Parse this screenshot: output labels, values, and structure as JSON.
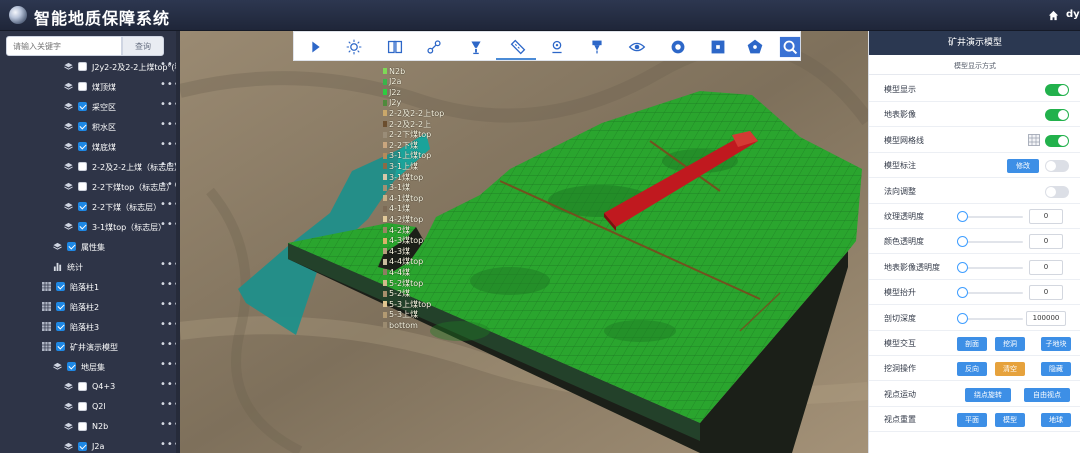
{
  "header": {
    "title": "智能地质保障系统",
    "user": "dy"
  },
  "sidebar": {
    "search_placeholder": "请输入关键字",
    "search_button": "查询",
    "rows": [
      {
        "label": "J2y2-2及2-2上煤top°(标志层)",
        "indent": 1,
        "icon": "layer",
        "checked": false,
        "more": true
      },
      {
        "label": "煤顶煤",
        "indent": 1,
        "icon": "layer",
        "checked": false,
        "more": true
      },
      {
        "label": "采空区",
        "indent": 1,
        "icon": "layer",
        "checked": true,
        "more": true
      },
      {
        "label": "积水区",
        "indent": 1,
        "icon": "layer",
        "checked": true,
        "more": true
      },
      {
        "label": "煤底煤",
        "indent": 1,
        "icon": "layer",
        "checked": true,
        "more": true
      },
      {
        "label": "2-2及2-2上煤（标志层）",
        "indent": 1,
        "icon": "layer",
        "checked": false,
        "more": true
      },
      {
        "label": "2-2下煤top（标志层）°",
        "indent": 1,
        "icon": "layer",
        "checked": false,
        "more": true
      },
      {
        "label": "2-2下煤（标志层）",
        "indent": 1,
        "icon": "layer",
        "checked": true,
        "more": true
      },
      {
        "label": "3-1煤top（标志层）",
        "indent": 1,
        "icon": "layer",
        "checked": true,
        "more": true
      },
      {
        "label": "属性集",
        "indent": 0.5,
        "icon": "layer",
        "checked": true,
        "more": false
      },
      {
        "label": "统计",
        "indent": 0.5,
        "icon": "bars",
        "checked": null,
        "more": true
      },
      {
        "label": "陷落柱1",
        "indent": 0,
        "icon": "grid",
        "checked": true,
        "more": true
      },
      {
        "label": "陷落柱2",
        "indent": 0,
        "icon": "grid",
        "checked": true,
        "more": true
      },
      {
        "label": "陷落柱3",
        "indent": 0,
        "icon": "grid",
        "checked": true,
        "more": true
      },
      {
        "label": "矿井演示模型",
        "indent": 0,
        "icon": "grid",
        "checked": true,
        "more": true
      },
      {
        "label": "地层集",
        "indent": 0.5,
        "icon": "layer",
        "checked": true,
        "more": true
      },
      {
        "label": "Q4+3",
        "indent": 1,
        "icon": "layer",
        "checked": false,
        "more": true
      },
      {
        "label": "Q2l",
        "indent": 1,
        "icon": "layer",
        "checked": false,
        "more": true
      },
      {
        "label": "N2b",
        "indent": 1,
        "icon": "layer",
        "checked": false,
        "more": true
      },
      {
        "label": "J2a",
        "indent": 1,
        "icon": "layer",
        "checked": true,
        "more": true
      }
    ]
  },
  "layers": [
    {
      "label": "N2b",
      "color": "#7ed957"
    },
    {
      "label": "J2a",
      "color": "#39b54a"
    },
    {
      "label": "J2z",
      "color": "#2ecc40"
    },
    {
      "label": "J2y",
      "color": "#4f8a3c"
    },
    {
      "label": "2-2及2-2上top",
      "color": "#caa86a"
    },
    {
      "label": "2-2及2-2上",
      "color": "#6b4e2e"
    },
    {
      "label": "2-2下煤top",
      "color": "#9a8d78"
    },
    {
      "label": "2-2下煤",
      "color": "#c9a67e"
    },
    {
      "label": "3-1上煤top",
      "color": "#b58b5a"
    },
    {
      "label": "3-1上煤",
      "color": "#8b6a45"
    },
    {
      "label": "3-1煤top",
      "color": "#d5c7a8"
    },
    {
      "label": "3-1煤",
      "color": "#a39173"
    },
    {
      "label": "4-1煤top",
      "color": "#c8b087"
    },
    {
      "label": "4-1煤",
      "color": "#7c6a55"
    },
    {
      "label": "4-2煤top",
      "color": "#e2c999"
    },
    {
      "label": "4-2煤",
      "color": "#9a8663"
    },
    {
      "label": "4-3煤top",
      "color": "#d9b26a"
    },
    {
      "label": "4-3煤",
      "color": "#b7a07d"
    },
    {
      "label": "4-4煤top",
      "color": "#c9bb9c"
    },
    {
      "label": "4-4煤",
      "color": "#8f7d62"
    },
    {
      "label": "5-2煤top",
      "color": "#d2b98c"
    },
    {
      "label": "5-2煤",
      "color": "#a78f6c"
    },
    {
      "label": "5-3上煤top",
      "color": "#e0c58f"
    },
    {
      "label": "5-3上煤",
      "color": "#b29a72"
    },
    {
      "label": "bottom",
      "color": "#9b8b70"
    }
  ],
  "toolbar": {
    "icons": [
      "play-icon",
      "sun-icon",
      "book-icon",
      "route-icon",
      "lamp-icon",
      "ruler-icon",
      "location-icon",
      "pin-icon",
      "eye-icon",
      "circle-icon",
      "square-icon",
      "pentagon-icon",
      "search-icon"
    ],
    "active_index": 5
  },
  "panel": {
    "title": "矿井演示模型",
    "subtitle": "模型显示方式",
    "rows": [
      {
        "label": "模型显示",
        "control": "toggle",
        "on": true
      },
      {
        "label": "地表影像",
        "control": "toggle",
        "on": true
      },
      {
        "label": "模型网格线",
        "control": "toggle_grid",
        "on": true
      },
      {
        "label": "模型标注",
        "control": "button_toggle",
        "button": "修改",
        "on": false
      },
      {
        "label": "法向调整",
        "control": "toggle",
        "on": false
      },
      {
        "label": "纹理透明度",
        "control": "slider",
        "value": "0"
      },
      {
        "label": "颜色透明度",
        "control": "slider",
        "value": "0"
      },
      {
        "label": "地表影像透明度",
        "control": "slider",
        "value": "0"
      },
      {
        "label": "模型抬升",
        "control": "slider",
        "value": "0"
      },
      {
        "label": "剖切深度",
        "control": "slider_wide",
        "value": "100000"
      },
      {
        "label": "模型交互",
        "control": "buttons",
        "buttons": [
          "剖面",
          "挖洞",
          "子地块"
        ]
      },
      {
        "label": "挖洞操作",
        "control": "buttons",
        "buttons": [
          "反向",
          "清空",
          "隐藏"
        ],
        "active": 1
      },
      {
        "label": "视点运动",
        "control": "buttons2",
        "buttons": [
          "绕点旋转",
          "自由视点"
        ]
      },
      {
        "label": "视点重置",
        "control": "buttons",
        "buttons": [
          "平面",
          "模型",
          "地球"
        ]
      }
    ]
  }
}
